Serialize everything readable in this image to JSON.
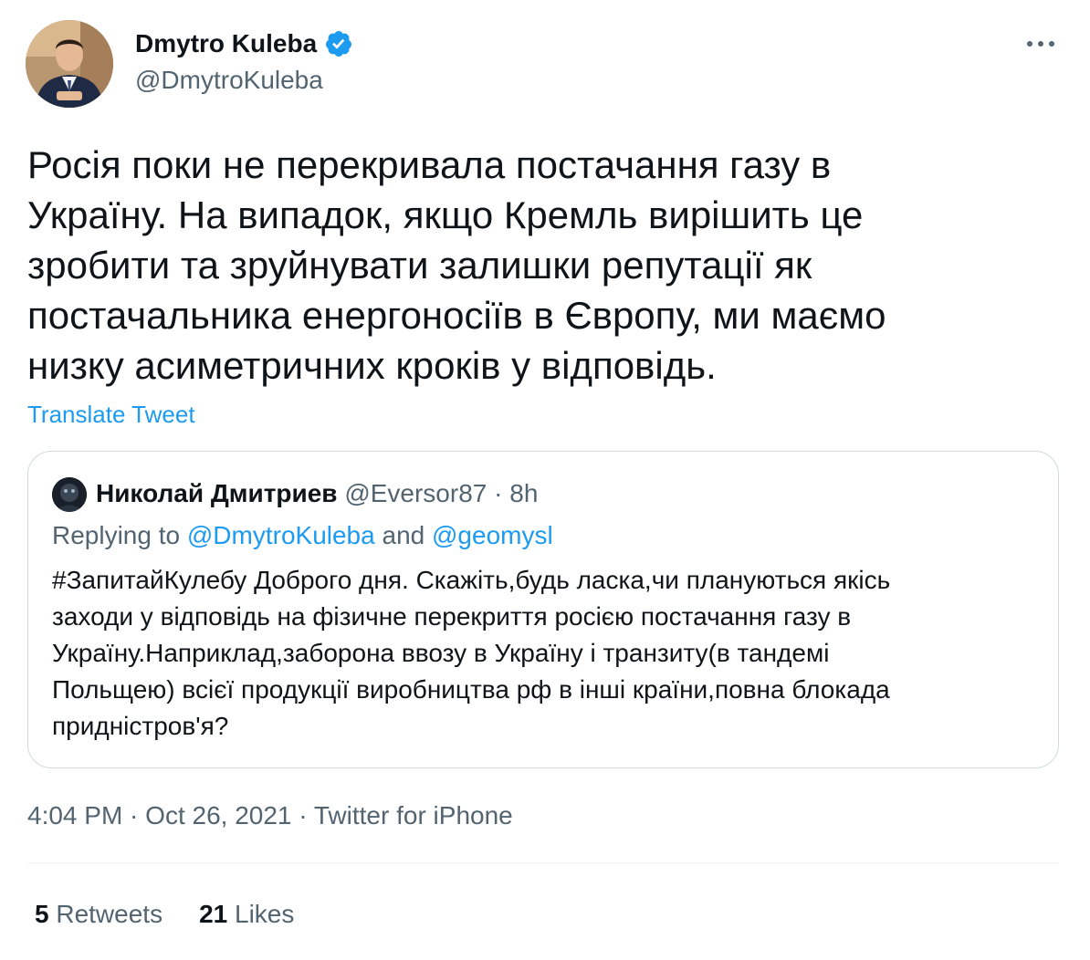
{
  "author": {
    "name": "Dmytro Kuleba",
    "handle": "@DmytroKuleba"
  },
  "tweet": {
    "text": "Росія поки не перекривала постачання газу в\nУкраїну. На випадок, якщо Кремль вирішить це\nзробити та зруйнувати залишки репутації як\nпостачальника енергоносіїв в Європу, ми маємо\nнизку асиметричних кроків у відповідь.",
    "translate_label": "Translate Tweet"
  },
  "quote": {
    "name": "Николай Дмитриев",
    "handle": "@Eversor87",
    "separator": " · ",
    "time": "8h",
    "replying_prefix": "Replying to ",
    "replying_to_1": "@DmytroKuleba",
    "replying_and": " and ",
    "replying_to_2": "@geomysl",
    "text": "#ЗапитайКулебу Доброго дня. Скажіть,будь ласка,чи плануються якісь\nзаходи у відповідь на фізичне перекриття росією постачання газу в\nУкраїну.Наприклад,заборона ввозу в Україну і транзиту(в тандемі\nПольщею) всієї продукції виробництва рф в інші країни,повна блокада\nпридністров'я?"
  },
  "meta": {
    "timestamp": "4:04 PM · Oct 26, 2021 · Twitter for iPhone"
  },
  "stats": {
    "retweets_count": "5",
    "retweets_label": " Retweets",
    "likes_count": "21",
    "likes_label": " Likes"
  },
  "colors": {
    "accent": "#1d9bf0",
    "secondary_text": "#536471",
    "border": "#cfd9de"
  },
  "icons": {
    "verified": "verified-badge-icon",
    "more": "more-options-icon"
  }
}
